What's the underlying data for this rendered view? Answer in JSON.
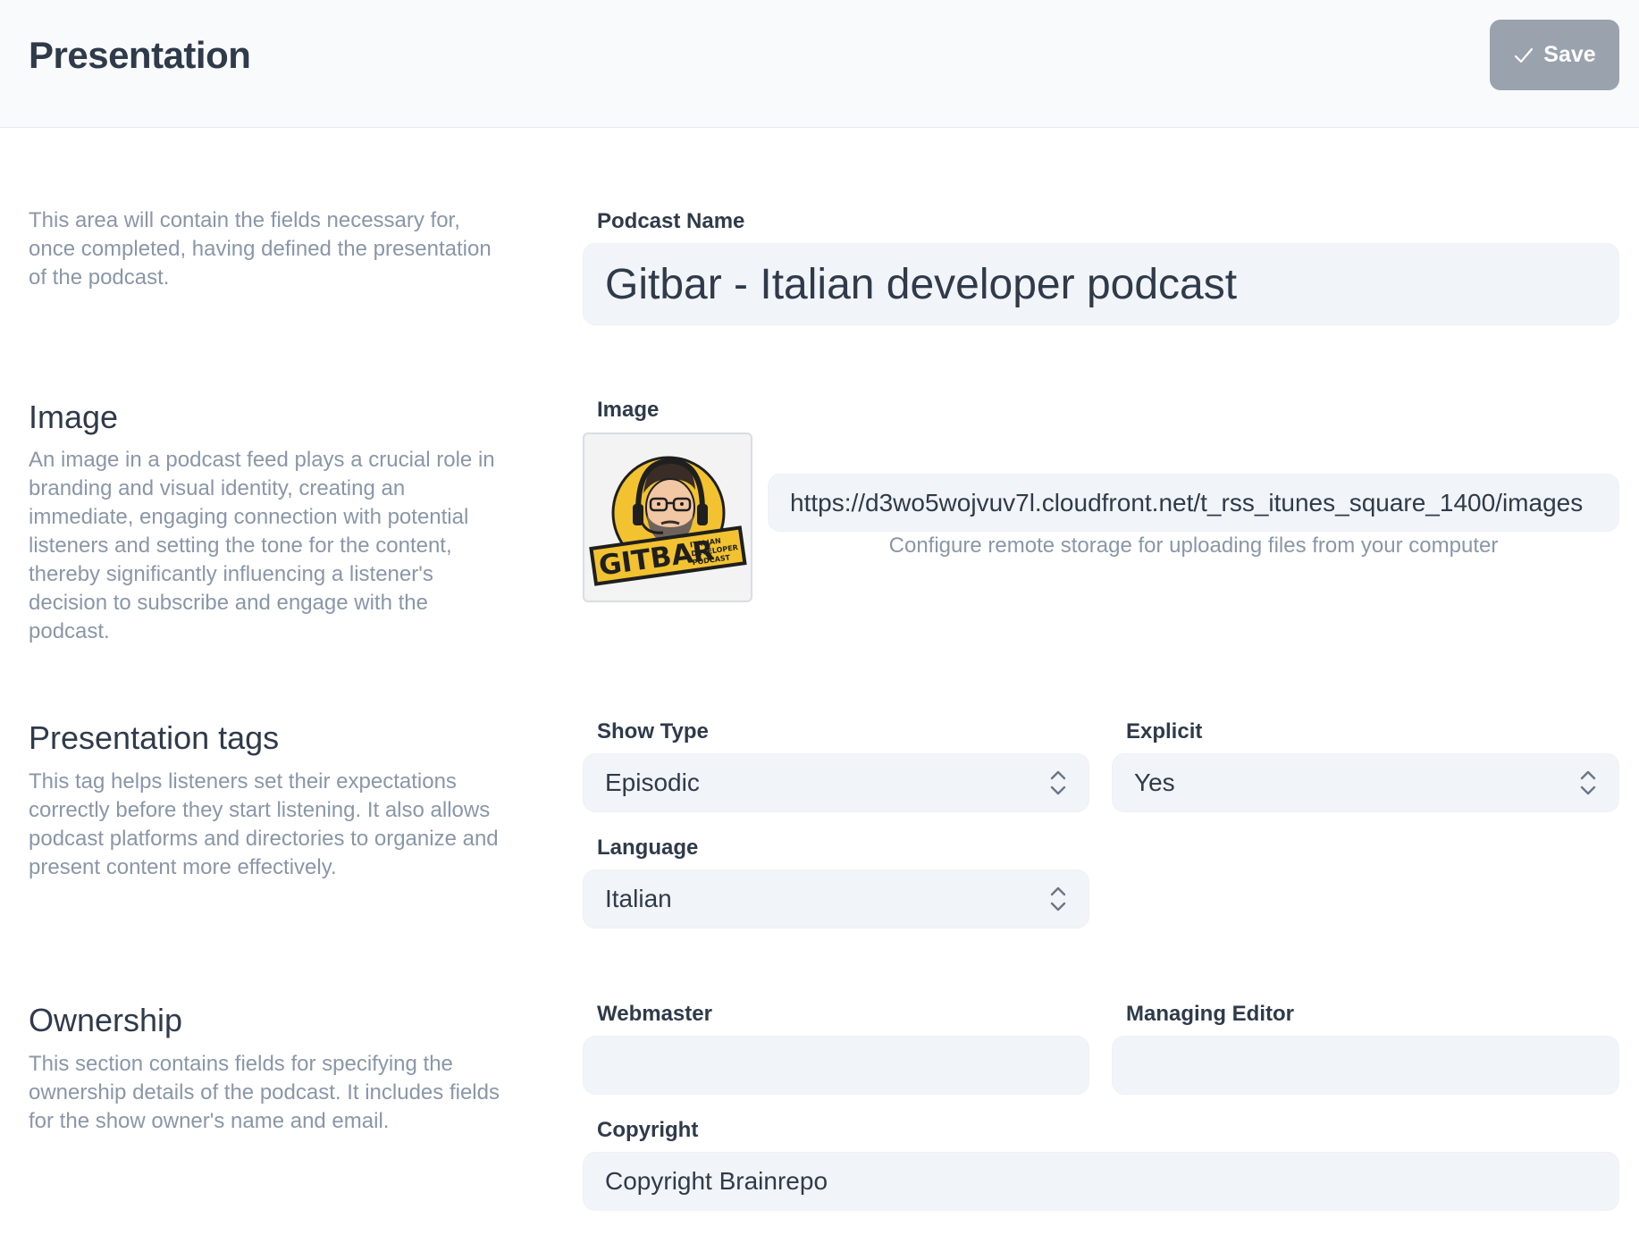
{
  "header": {
    "title": "Presentation",
    "save_label": "Save"
  },
  "intro": {
    "description": "This area will contain the fields necessary for, once completed, having defined the presentation of the podcast."
  },
  "fields": {
    "podcast_name": {
      "label": "Podcast Name",
      "value": "Gitbar - Italian developer podcast"
    },
    "image": {
      "label": "Image",
      "url": "https://d3wo5wojvuv7l.cloudfront.net/t_rss_itunes_square_1400/images",
      "helper": "Configure remote storage for uploading files from your computer",
      "logo_text": "GITBAR",
      "logo_subtext": [
        "ITALIAN",
        "DEVELOPER",
        "PODCAST"
      ]
    },
    "show_type": {
      "label": "Show Type",
      "value": "Episodic"
    },
    "explicit": {
      "label": "Explicit",
      "value": "Yes"
    },
    "language": {
      "label": "Language",
      "value": "Italian"
    },
    "webmaster": {
      "label": "Webmaster",
      "value": ""
    },
    "managing_editor": {
      "label": "Managing Editor",
      "value": ""
    },
    "copyright": {
      "label": "Copyright",
      "value": "Copyright Brainrepo"
    }
  },
  "sections": {
    "image": {
      "heading": "Image",
      "description": "An image in a podcast feed plays a crucial role in branding and visual identity, creating an immediate, engaging connection with potential listeners and setting the tone for the content, thereby significantly influencing a listener's decision to subscribe and engage with the podcast."
    },
    "tags": {
      "heading": "Presentation tags",
      "description": "This tag helps listeners set their expectations correctly before they start listening. It also allows podcast platforms and directories to organize and present content more effectively."
    },
    "ownership": {
      "heading": "Ownership",
      "description": "This section contains fields for specifying the ownership details of the podcast. It includes fields for the show owner's name and email."
    }
  },
  "colors": {
    "text_primary": "#2f3a4a",
    "text_muted": "#8a96a8",
    "field_bg": "#f1f4f8",
    "save_button_bg": "#9aa2ae",
    "logo_yellow": "#f2c230"
  },
  "icons": {
    "save": "check-icon",
    "select": "chevron-up-down-icon"
  }
}
